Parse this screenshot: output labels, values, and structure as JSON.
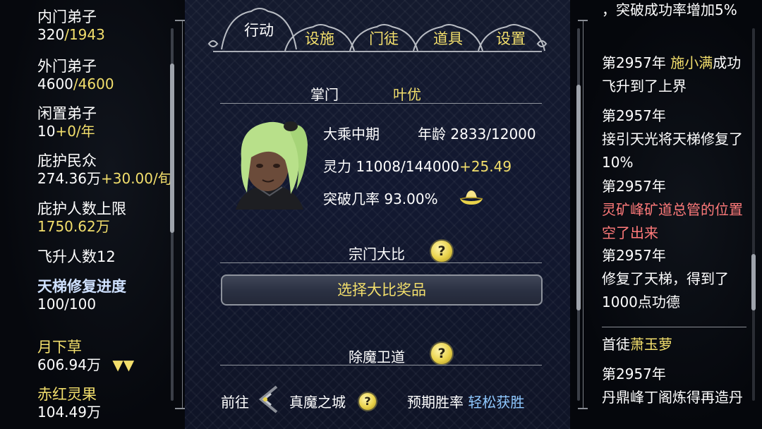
{
  "left_panel": {
    "inner_disciples": {
      "label": "内门弟子",
      "current": "320",
      "sep": "/",
      "max": "1943"
    },
    "outer_disciples": {
      "label": "外门弟子",
      "current": "4600",
      "sep": "/",
      "max": "4600"
    },
    "idle_disciples": {
      "label": "闲置弟子",
      "current": "10",
      "rate": "+0/年"
    },
    "protected_people": {
      "label": "庇护民众",
      "current": "274.36万",
      "rate": "+30.00/旬"
    },
    "protected_cap": {
      "label": "庇护人数上限",
      "value": "1750.62万"
    },
    "ascended": {
      "label": "飞升人数12"
    },
    "ladder_progress": {
      "label": "天梯修复进度",
      "value": "100/100"
    },
    "resources": [
      {
        "name": "月下草",
        "amount": "606.94万",
        "trend": "▼▼"
      },
      {
        "name": "赤红灵果",
        "amount": "104.49万"
      }
    ]
  },
  "tabs": [
    {
      "label": "行动",
      "active": true
    },
    {
      "label": "设施",
      "active": false
    },
    {
      "label": "门徒",
      "active": false
    },
    {
      "label": "道具",
      "active": false
    },
    {
      "label": "设置",
      "active": false
    }
  ],
  "leader": {
    "title": "掌门",
    "name": "叶优",
    "realm": "大乘中期",
    "age_label": "年龄",
    "age": "2833/12000",
    "spirit_label": "灵力",
    "spirit": "11008/144000",
    "spirit_rate": "+25.49",
    "breakthrough_label": "突破几率",
    "breakthrough": "93.00%"
  },
  "tournament": {
    "title": "宗门大比",
    "help": "?",
    "button": "选择大比奖品"
  },
  "demon_guard": {
    "title": "除魔卫道",
    "help": "?",
    "go_label": "前往",
    "destination": "真魔之城",
    "win_label": "预期胜率",
    "win_value": "轻松获胜"
  },
  "log_entries": [
    {
      "text": "，突破成功率增加5%"
    },
    {
      "year": "第2957年",
      "name": "施小满",
      "text": "成功飞升到了上界"
    },
    {
      "year": "第2957年",
      "text": "接引天光将天梯修复了10%"
    },
    {
      "year": "第2957年",
      "highlight": "灵矿峰矿道总管的位置空了出来"
    },
    {
      "year": "第2957年",
      "text": "修复了天梯，得到了1000点功德"
    }
  ],
  "disciple_log": {
    "head_label": "首徒",
    "head_name": "萧玉萝",
    "entries": [
      {
        "year": "第2957年",
        "text": "丹鼎峰丁阁炼得再造丹"
      }
    ]
  },
  "colors": {
    "accent_yellow": "#f3df6c",
    "warning_red": "#ff7a7a",
    "highlight_blue": "#cfe1ff"
  }
}
